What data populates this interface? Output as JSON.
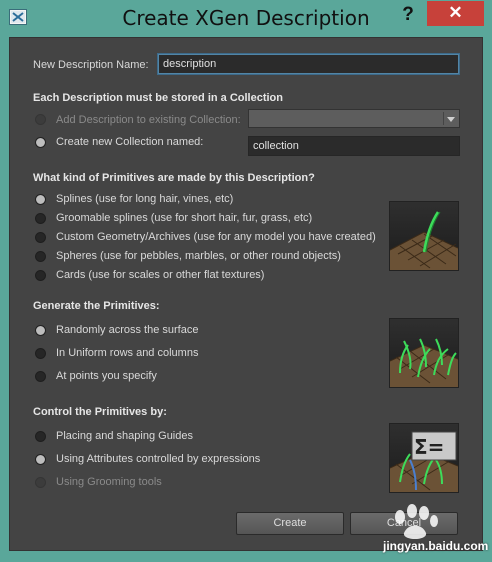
{
  "window": {
    "title": "Create XGen Description",
    "help_label": "?",
    "close_label": "✕"
  },
  "name_row": {
    "label": "New Description Name:",
    "value": "description"
  },
  "collection": {
    "header": "Each Description must be stored in a Collection",
    "add_existing_label": "Add Description to existing Collection:",
    "add_existing_selected": "",
    "create_new_label": "Create new Collection named:",
    "create_new_value": "collection",
    "selected": "create_new"
  },
  "primitives": {
    "header": "What kind of Primitives are made by this Description?",
    "options": [
      "Splines (use for long hair, vines, etc)",
      "Groomable splines (use for short hair, fur, grass, etc)",
      "Custom Geometry/Archives (use for any model you have created)",
      "Spheres (use for pebbles, marbles, or other round objects)",
      "Cards (use for scales or other flat textures)"
    ],
    "selected_index": 0
  },
  "generate": {
    "header": "Generate the Primitives:",
    "options": [
      "Randomly across the surface",
      "In Uniform rows and columns",
      "At points you specify"
    ],
    "selected_index": 0
  },
  "control": {
    "header": "Control the Primitives by:",
    "options": [
      "Placing and shaping Guides",
      "Using Attributes controlled by expressions",
      "Using Grooming tools"
    ],
    "selected_index": 1,
    "disabled_index": 2
  },
  "buttons": {
    "create_label": "Create",
    "cancel_label": "Cancel"
  },
  "watermark": {
    "text": "jingyan.baidu.com"
  },
  "colors": {
    "accent_green": "#3ddc5a",
    "guide_blue": "#4a7fd0",
    "close_red": "#c7413a"
  }
}
